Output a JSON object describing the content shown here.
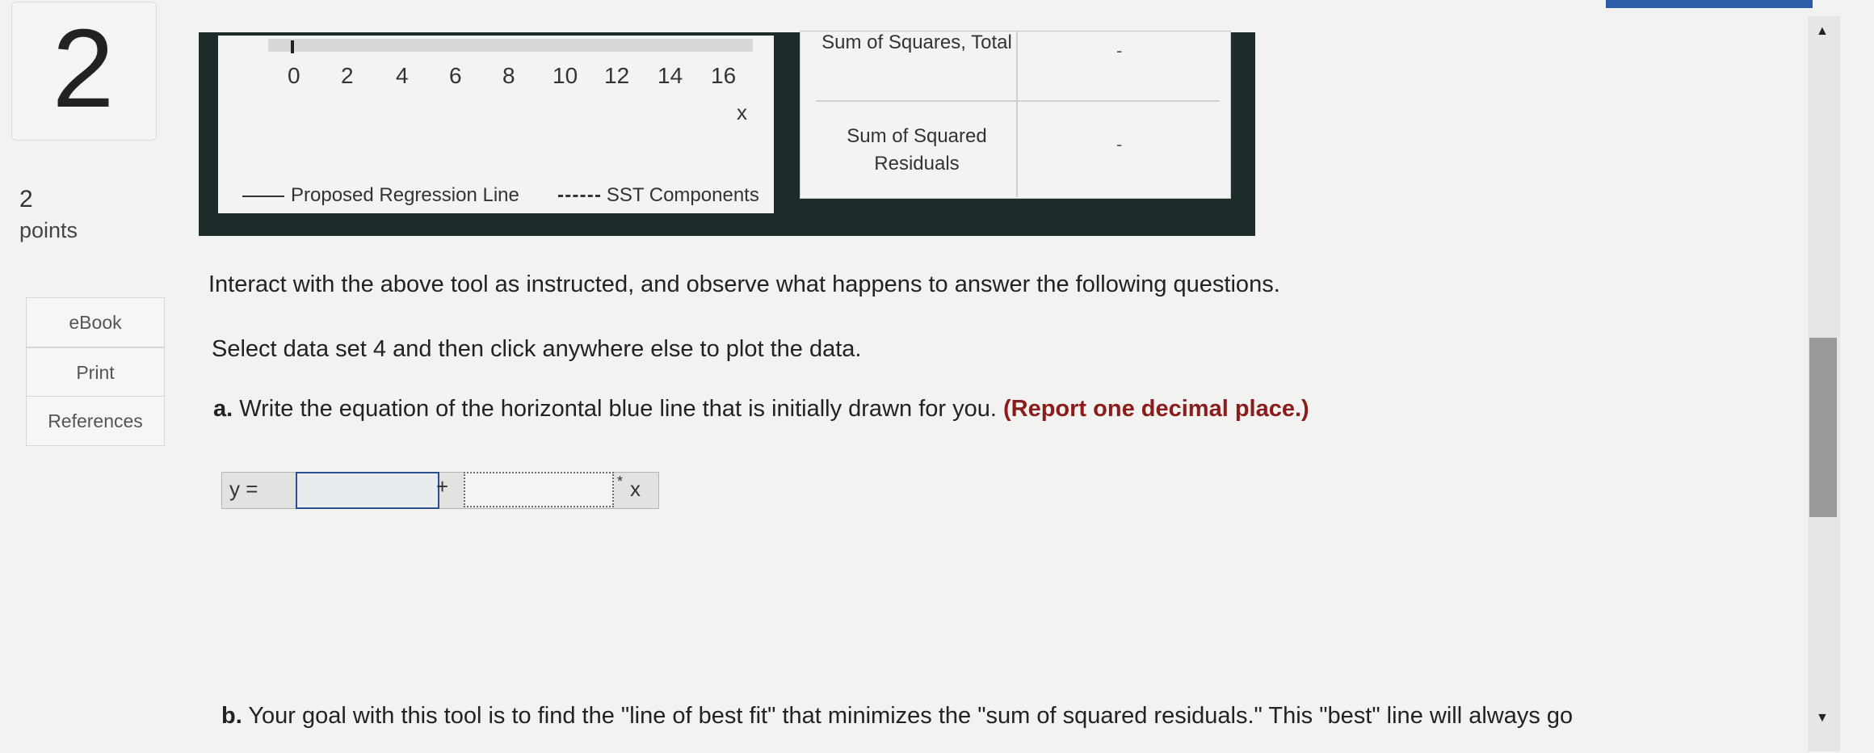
{
  "question": {
    "number": "2",
    "points_value": "2",
    "points_label": "points"
  },
  "side_buttons": [
    "eBook",
    "Print",
    "References"
  ],
  "graph": {
    "x_ticks": [
      "0",
      "2",
      "4",
      "6",
      "8",
      "10",
      "12",
      "14",
      "16"
    ],
    "x_label": "x",
    "legend": {
      "solid": "Proposed Regression Line",
      "dashed": "SST Components"
    }
  },
  "table": {
    "row1_label": "Sum of Squares, Total",
    "row2_label": "Sum of Squared Residuals",
    "row1_value": "-",
    "row2_value": "-"
  },
  "instructions": {
    "intro": "Interact with the above tool as instructed, and observe what happens to answer the following questions.",
    "step": "Select data set 4 and then click anywhere else to plot the data.",
    "a_prefix": "a.",
    "a_text": "Write the equation of the horizontal blue line that is initially drawn for you.",
    "a_emphasis": "(Report one decimal place.)",
    "b_prefix": "b.",
    "b_text": "Your goal with this tool is to find the \"line of best fit\" that minimizes the \"sum of squared residuals.\" This \"best\" line will always go"
  },
  "equation": {
    "y_label": "y =",
    "plus": "+",
    "times": "*",
    "x": "x",
    "intercept_value": "",
    "slope_value": ""
  }
}
